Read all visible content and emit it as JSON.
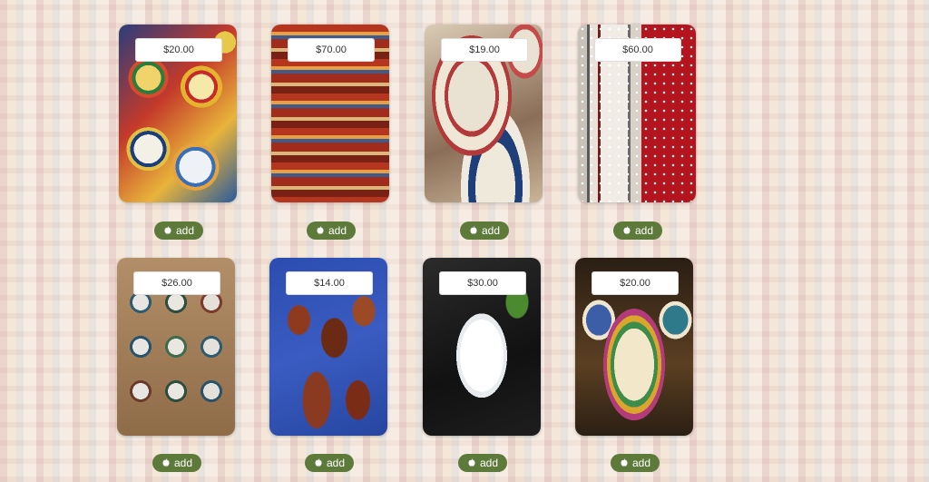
{
  "products": [
    {
      "price": "$20.00",
      "add_label": "add",
      "image_name": "ceramic-bowls-image"
    },
    {
      "price": "$70.00",
      "add_label": "add",
      "image_name": "rugs-image"
    },
    {
      "price": "$19.00",
      "add_label": "add",
      "image_name": "plates-image"
    },
    {
      "price": "$60.00",
      "add_label": "add",
      "image_name": "textile-image"
    },
    {
      "price": "$26.00",
      "add_label": "add",
      "image_name": "wall-plates-image"
    },
    {
      "price": "$14.00",
      "add_label": "add",
      "image_name": "leather-bags-image"
    },
    {
      "price": "$30.00",
      "add_label": "add",
      "image_name": "porcelain-vase-image"
    },
    {
      "price": "$20.00",
      "add_label": "add",
      "image_name": "tagines-image"
    }
  ],
  "colors": {
    "add_button": "#5e7a3a",
    "price_bg": "#ffffff"
  },
  "icons": {
    "add_icon": "apple-icon"
  }
}
